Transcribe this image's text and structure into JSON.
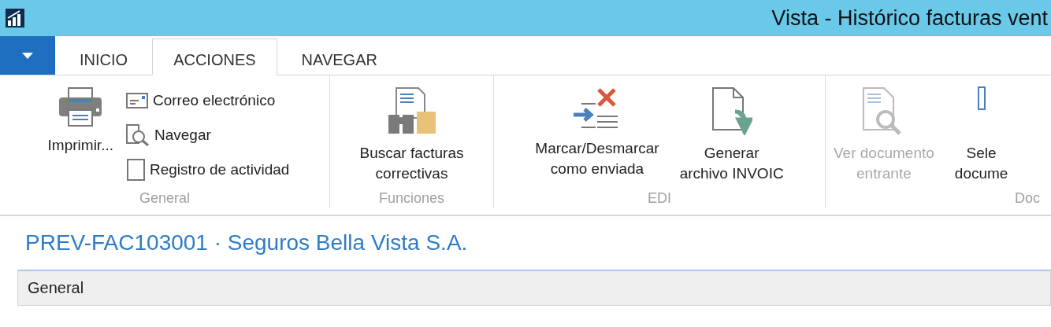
{
  "window": {
    "title": "Vista - Histórico facturas vent"
  },
  "tabs": [
    {
      "label": "INICIO",
      "selected": false
    },
    {
      "label": "ACCIONES",
      "selected": true
    },
    {
      "label": "NAVEGAR",
      "selected": false
    }
  ],
  "ribbon_groups": [
    {
      "label": "General",
      "actions": [
        {
          "kind": "large",
          "label": "Imprimir...",
          "disabled": false
        },
        {
          "kind": "small",
          "label": "Correo electrónico",
          "disabled": false
        },
        {
          "kind": "small",
          "label": "Navegar",
          "disabled": false
        },
        {
          "kind": "small",
          "label": "Registro de actividad",
          "disabled": false
        }
      ]
    },
    {
      "label": "Funciones",
      "actions": [
        {
          "kind": "large",
          "label": "Buscar facturas\ncorrectivas",
          "disabled": false
        }
      ]
    },
    {
      "label": "EDI",
      "actions": [
        {
          "kind": "large",
          "label": "Marcar/Desmarcar\ncomo enviada",
          "disabled": false
        },
        {
          "kind": "large",
          "label": "Generar\narchivo INVOIC",
          "disabled": false
        }
      ]
    },
    {
      "label": "Doc",
      "actions": [
        {
          "kind": "large",
          "label": "Ver documento\nentrante",
          "disabled": true
        },
        {
          "kind": "large",
          "label": "Sele\ndocume",
          "disabled": false
        }
      ]
    }
  ],
  "page": {
    "title": "PREV-FAC103001 · Seguros Bella Vista S.A.",
    "sections": [
      {
        "label": "General"
      }
    ]
  }
}
